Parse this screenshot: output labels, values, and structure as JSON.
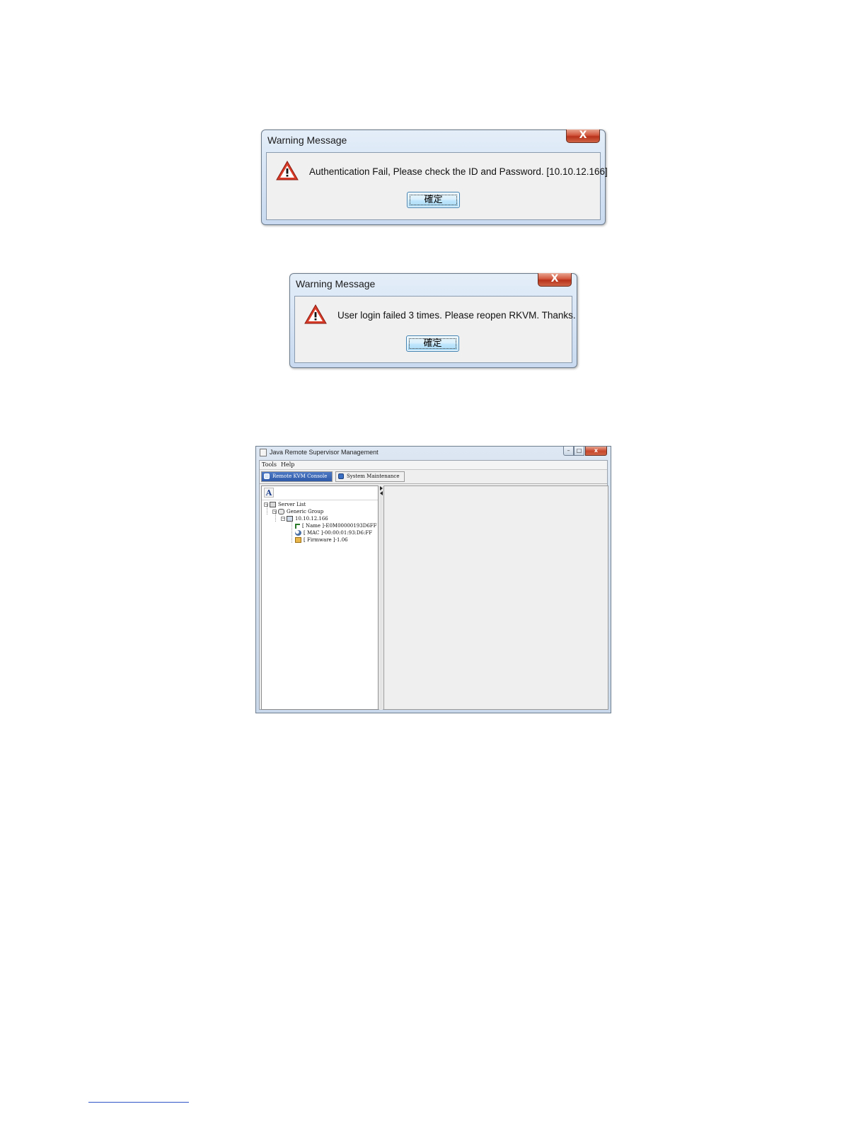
{
  "dialog_auth_fail": {
    "title": "Warning Message",
    "close_label": "X",
    "icon": "warning-icon",
    "message": "Authentication Fail, Please check the ID and Password. [10.10.12.166]",
    "ok_label": "確定"
  },
  "dialog_login_failed": {
    "title": "Warning Message",
    "close_label": "X",
    "icon": "warning-icon",
    "message": "User login failed 3 times. Please reopen RKVM. Thanks.",
    "ok_label": "確定"
  },
  "app_window": {
    "title": "Java Remote Supervisor Management",
    "controls": {
      "minimize": "–",
      "maximize": "□",
      "close": "x"
    },
    "menu": [
      "Tools",
      "Help"
    ],
    "tabs": [
      "Remote KVM Console",
      "System Maintenance"
    ],
    "active_tab": "Remote KVM Console",
    "font_button": "A",
    "tree": {
      "root": "Server List",
      "group": "Generic Group",
      "host": "10.10.12.166",
      "name": "[ Name ]-E0M00000193D6FF",
      "mac": "[ MAC ]-00:00:01:93:D6:FF",
      "firmware": "[ Firmware ]-1.06"
    }
  },
  "colors": {
    "title_bar": "#c9daf0",
    "close_button": "#c8462b",
    "active_tab": "#2f5aa8",
    "footnote_rule": "#2f55c7"
  }
}
